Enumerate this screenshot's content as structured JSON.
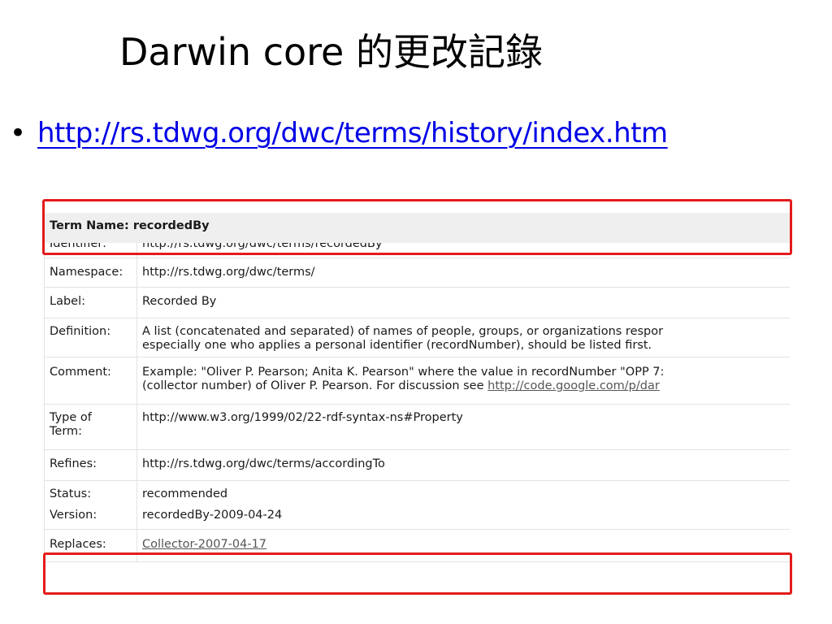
{
  "slide": {
    "title": "Darwin core 的更改記錄",
    "bullet_link": "http://rs.tdwg.org/dwc/terms/history/index.htm"
  },
  "term_table": {
    "header": "Term Name: recordedBy",
    "rows": [
      {
        "label": "Identifier:",
        "value": "http://rs.tdwg.org/dwc/terms/recordedBy"
      },
      {
        "label": "Namespace:",
        "value": "http://rs.tdwg.org/dwc/terms/"
      },
      {
        "label": "Label:",
        "value": "Recorded By"
      },
      {
        "label": "Definition:",
        "value_line1": "A list (concatenated and separated) of names of people, groups, or organizations respor",
        "value_line2": "especially one who applies a personal identifier (recordNumber), should be listed first."
      },
      {
        "label": "Comment:",
        "value_line1": "Example: \"Oliver P. Pearson; Anita K. Pearson\" where the value in recordNumber \"OPP 7:",
        "value_line2_text": "(collector number) of Oliver P. Pearson. For discussion see ",
        "value_line2_link": "http://code.google.com/p/dar"
      },
      {
        "label_line1": "Type of",
        "label_line2": "Term:",
        "value": "http://www.w3.org/1999/02/22-rdf-syntax-ns#Property"
      },
      {
        "label": "Refines:",
        "value": "http://rs.tdwg.org/dwc/terms/accordingTo"
      },
      {
        "label": "Status:",
        "value": "recommended"
      },
      {
        "label": "Version:",
        "value": "recordedBy-2009-04-24"
      },
      {
        "label": "Replaces:",
        "value": "Collector-2007-04-17"
      }
    ]
  },
  "colors": {
    "highlight": "#e31b1b",
    "link": "#0000e6",
    "header_bg": "#efefef"
  }
}
